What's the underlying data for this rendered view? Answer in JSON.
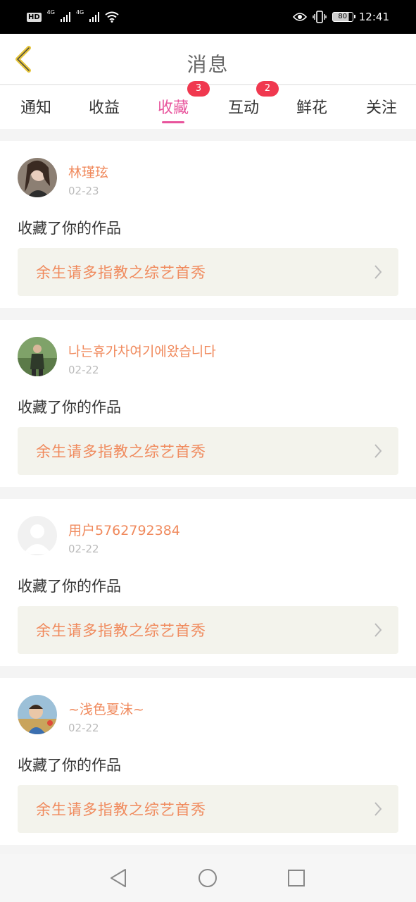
{
  "status_bar": {
    "hd": "HD",
    "net1": "4G",
    "net2": "4G",
    "battery": "80",
    "time": "12:41"
  },
  "header": {
    "title": "消息"
  },
  "tabs": [
    {
      "label": "通知",
      "badge": ""
    },
    {
      "label": "收益",
      "badge": ""
    },
    {
      "label": "收藏",
      "badge": "3"
    },
    {
      "label": "互动",
      "badge": "2"
    },
    {
      "label": "鲜花",
      "badge": ""
    },
    {
      "label": "关注",
      "badge": ""
    }
  ],
  "colors": {
    "accent": "#e8549c",
    "badge": "#f0384f",
    "name": "#f08a5d"
  },
  "items": [
    {
      "username": "林瑾玹",
      "date": "02-23",
      "action": "收藏了你的作品",
      "work_title": "余生请多指教之综艺首秀",
      "avatar": "photo-woman"
    },
    {
      "username": "나는휴가차여기에왔습니다",
      "date": "02-22",
      "action": "收藏了你的作品",
      "work_title": "余生请多指教之综艺首秀",
      "avatar": "photo-man"
    },
    {
      "username": "用户5762792384",
      "date": "02-22",
      "action": "收藏了你的作品",
      "work_title": "余生请多指教之综艺首秀",
      "avatar": "default-user"
    },
    {
      "username": "~浅色夏沫~",
      "date": "02-22",
      "action": "收藏了你的作品",
      "work_title": "余生请多指教之综艺首秀",
      "avatar": "photo-child"
    }
  ]
}
